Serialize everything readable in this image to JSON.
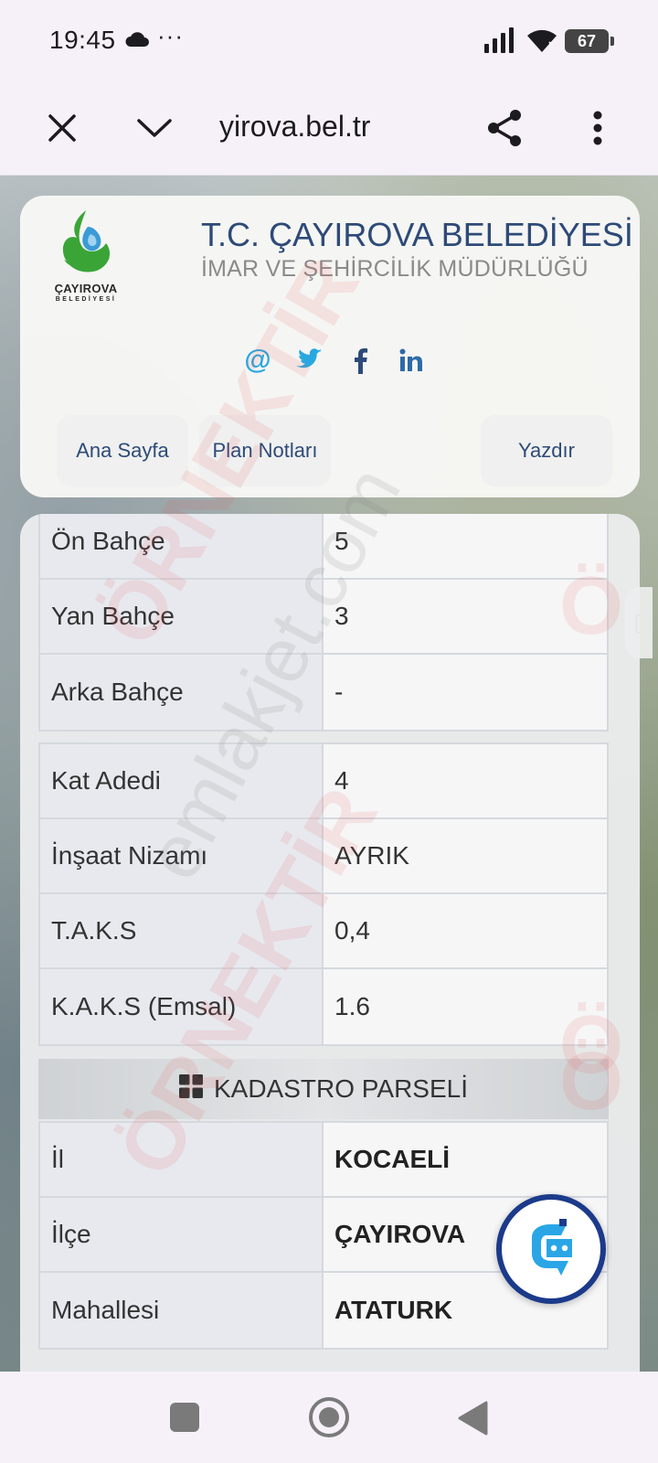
{
  "status": {
    "time": "19:45",
    "dots": "···",
    "battery": "67"
  },
  "browser": {
    "url": "yirova.bel.tr"
  },
  "header": {
    "logo_line1": "ÇAYIROVA",
    "logo_line2": "BELEDİYESİ",
    "title": "T.C. ÇAYIROVA BELEDİYESİ",
    "subtitle": "İMAR VE ŞEHİRCİLİK MÜDÜRLÜĞÜ",
    "social": {
      "email": "@"
    },
    "nav": {
      "home": "Ana Sayfa",
      "plan_notes": "Plan Notları",
      "print": "Yazdır",
      "extra": "["
    }
  },
  "table": {
    "setbacks": [
      {
        "label": "Ön Bahçe",
        "value": "5"
      },
      {
        "label": "Yan Bahçe",
        "value": "3"
      },
      {
        "label": "Arka Bahçe",
        "value": "-"
      }
    ],
    "building": [
      {
        "label": "Kat Adedi",
        "value": "4"
      },
      {
        "label": "İnşaat Nizamı",
        "value": "AYRIK"
      },
      {
        "label": "T.A.K.S",
        "value": "0,4"
      },
      {
        "label": "K.A.K.S (Emsal)",
        "value": "1.6"
      }
    ],
    "cadastre_header": "KADASTRO PARSELİ",
    "cadastre": [
      {
        "label": "İl",
        "value": "KOCAELİ"
      },
      {
        "label": "İlçe",
        "value": "ÇAYIROVA"
      },
      {
        "label": "Mahallesi",
        "value": "ATATURK"
      }
    ]
  },
  "watermarks": {
    "site": "emlakjet.com",
    "sample1": "ÖRNEKTİR",
    "sample2": "ÖRNEKTİR",
    "sample3": "Ö",
    "sample4": "Ö",
    "sample5": "Ö"
  },
  "colors": {
    "title_blue": "#2e4a78",
    "social_blue": "#29a8e0",
    "fab_ring": "#1b3a8a",
    "logo_green": "#3aa536",
    "logo_water": "#3b9bd6"
  }
}
